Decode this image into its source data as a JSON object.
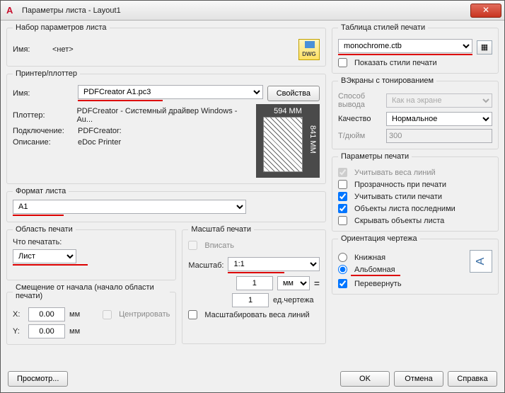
{
  "window": {
    "title": "Параметры листа - Layout1"
  },
  "pageset": {
    "legend": "Набор параметров листа",
    "name_lbl": "Имя:",
    "name_val": "<нет>"
  },
  "plotstyle": {
    "legend": "Таблица стилей печати",
    "value": "monochrome.ctb",
    "show_lbl": "Показать стили печати"
  },
  "printer": {
    "legend": "Принтер/плоттер",
    "name_lbl": "Имя:",
    "name_val": "PDFCreator A1.pc3",
    "props_btn": "Свойства",
    "plotter_lbl": "Плоттер:",
    "plotter_val": "PDFCreator - Системный драйвер Windows - Au...",
    "conn_lbl": "Подключение:",
    "conn_val": "PDFCreator:",
    "desc_lbl": "Описание:",
    "desc_val": "eDoc Printer",
    "preview_w": "594 MM",
    "preview_h": "841 MM"
  },
  "viewport": {
    "legend": "ВЭкраны с тонированием",
    "mode_lbl": "Способ вывода",
    "mode_val": "Как на экране",
    "quality_lbl": "Качество",
    "quality_val": "Нормальное",
    "dpi_lbl": "Т/дюйм",
    "dpi_val": "300"
  },
  "paper": {
    "legend": "Формат листа",
    "value": "A1"
  },
  "plotopts": {
    "legend": "Параметры печати",
    "lw": "Учитывать веса линий",
    "trans": "Прозрачность при печати",
    "styles": "Учитывать стили печати",
    "last": "Объекты листа последними",
    "hide": "Скрывать объекты листа"
  },
  "area": {
    "legend": "Область печати",
    "what_lbl": "Что печатать:",
    "what_val": "Лист"
  },
  "offset": {
    "legend": "Смещение от начала (начало области печати)",
    "x_lbl": "X:",
    "x_val": "0.00",
    "y_lbl": "Y:",
    "y_val": "0.00",
    "unit": "мм",
    "center": "Центрировать"
  },
  "scale": {
    "legend": "Масштаб печати",
    "fit": "Вписать",
    "scale_lbl": "Масштаб:",
    "scale_val": "1:1",
    "num": "1",
    "unit_sel": "мм",
    "den": "1",
    "du": "ед.чертежа",
    "scale_lw": "Масштабировать веса линий"
  },
  "orient": {
    "legend": "Ориентация чертежа",
    "portrait": "Книжная",
    "landscape": "Альбомная",
    "upside": "Перевернуть"
  },
  "footer": {
    "preview": "Просмотр...",
    "ok": "OK",
    "cancel": "Отмена",
    "help": "Справка"
  }
}
